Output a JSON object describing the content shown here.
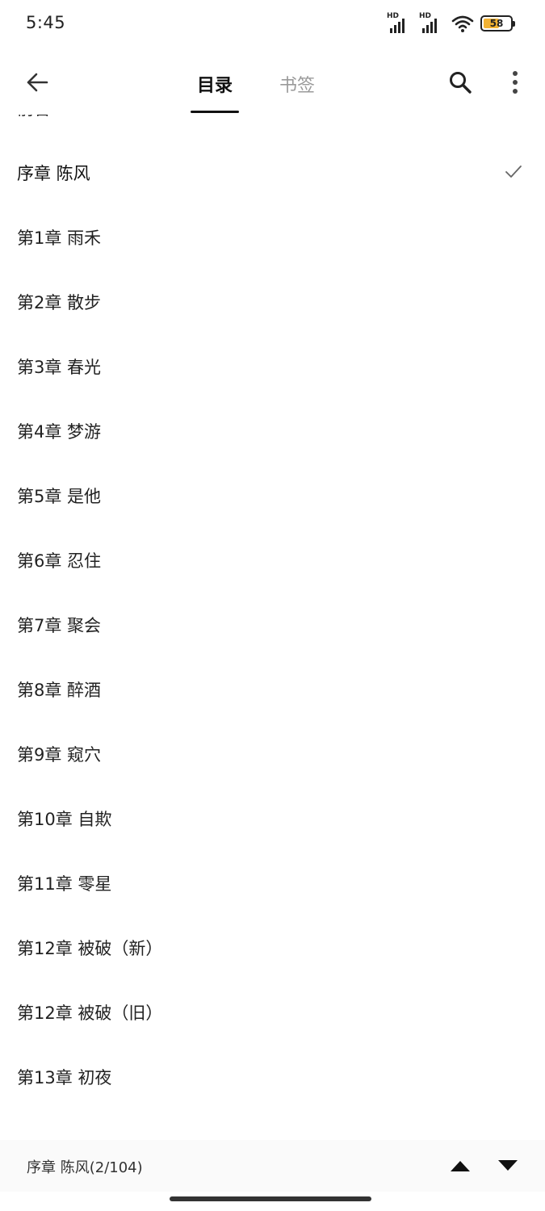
{
  "status_bar": {
    "time": "5:45",
    "signal_1_label": "HD",
    "signal_2_label": "HD",
    "battery_percent": 58,
    "battery_label": "58",
    "battery_color": "#f2b234"
  },
  "app_bar": {
    "back_icon": "arrow-left-icon",
    "tabs": [
      {
        "label": "目录",
        "active": true
      },
      {
        "label": "书签",
        "active": false
      }
    ],
    "search_icon": "search-icon",
    "more_icon": "more-vertical-icon"
  },
  "chapters": [
    {
      "title": "前言"
    },
    {
      "title": "序章 陈风",
      "current": true
    },
    {
      "title": "第1章 雨禾"
    },
    {
      "title": "第2章 散步"
    },
    {
      "title": "第3章 春光"
    },
    {
      "title": "第4章 梦游"
    },
    {
      "title": "第5章 是他"
    },
    {
      "title": "第6章 忍住"
    },
    {
      "title": "第7章 聚会"
    },
    {
      "title": "第8章 醉酒"
    },
    {
      "title": "第9章 窥穴"
    },
    {
      "title": "第10章 自欺"
    },
    {
      "title": "第11章 零星"
    },
    {
      "title": "第12章 被破（新）"
    },
    {
      "title": "第12章 被破（旧）"
    },
    {
      "title": "第13章 初夜"
    }
  ],
  "bottom_bar": {
    "current_label": "序章 陈风(2/104)",
    "up_icon": "triangle-up-icon",
    "down_icon": "triangle-down-icon"
  }
}
